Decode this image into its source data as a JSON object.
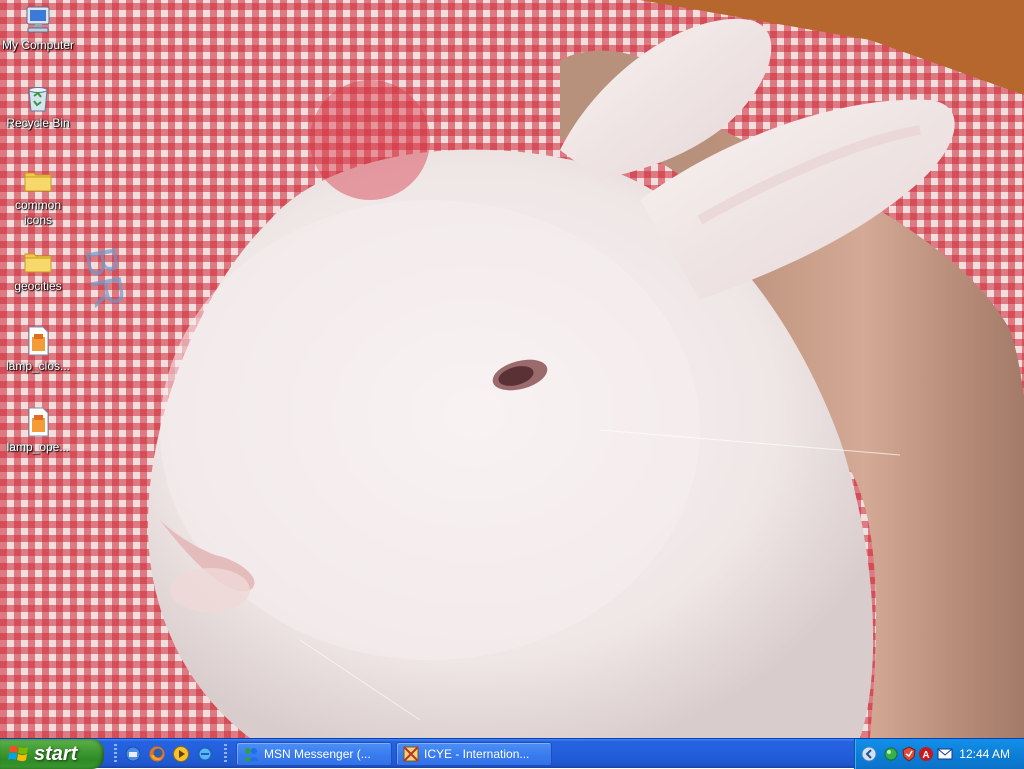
{
  "desktop": {
    "icons": [
      {
        "label": "My Computer",
        "icon": "my-computer-icon"
      },
      {
        "label": "Recycle Bin",
        "icon": "recycle-bin-icon"
      },
      {
        "label": "common icons",
        "icon": "folder-icon"
      },
      {
        "label": "geocities",
        "icon": "folder-icon"
      },
      {
        "label": "lamp_clos...",
        "icon": "image-file-icon"
      },
      {
        "label": "lamp_ope...",
        "icon": "image-file-icon"
      }
    ]
  },
  "taskbar": {
    "start_label": "start",
    "quick_launch": [
      "show-desktop-icon",
      "firefox-icon",
      "media-icon",
      "internet-explorer-icon"
    ],
    "tasks": [
      {
        "label": "MSN Messenger (...",
        "icon": "msn-messenger-icon"
      },
      {
        "label": "ICYE - Internation...",
        "icon": "app-window-icon"
      }
    ],
    "tray": {
      "icons": [
        "show-hidden-icons-chevron",
        "network-icon",
        "security-icon",
        "antivirus-icon",
        "mail-icon"
      ],
      "clock": "12:44 AM"
    }
  },
  "colors": {
    "taskbar_blue": "#245edb",
    "start_green": "#3f9a33",
    "tray_blue": "#0d7fd8"
  }
}
